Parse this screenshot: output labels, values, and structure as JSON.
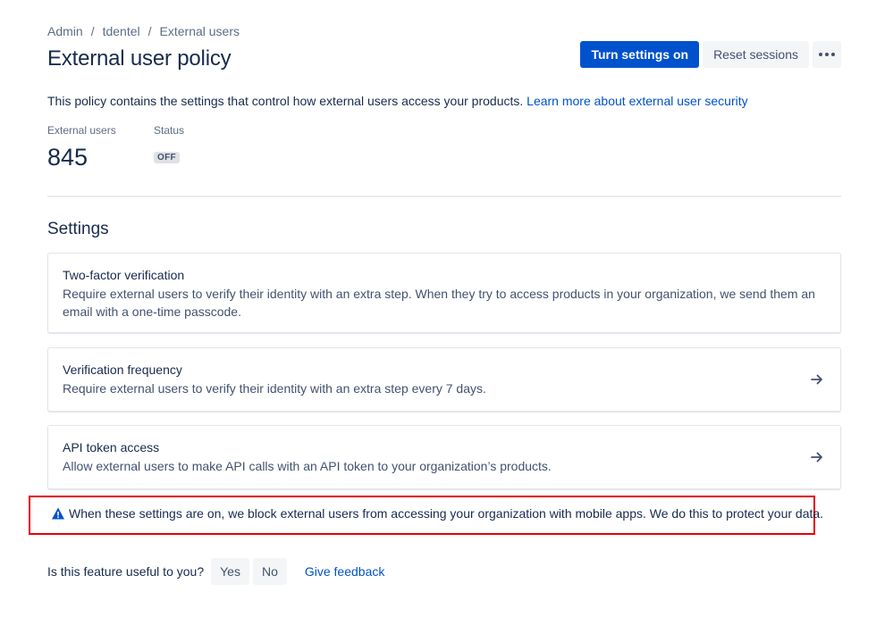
{
  "breadcrumb": {
    "items": [
      "Admin",
      "tdentel",
      "External users"
    ],
    "separator": "/"
  },
  "page": {
    "title": "External user policy"
  },
  "actions": {
    "primary_label": "Turn settings on",
    "reset_label": "Reset sessions",
    "more_icon": "more-horizontal-icon"
  },
  "description": {
    "text": "This policy contains the settings that control how external users access your products.",
    "link_text": "Learn more about external user security"
  },
  "stats": {
    "users_label": "External users",
    "users_value": "845",
    "status_label": "Status",
    "status_value": "OFF"
  },
  "settings": {
    "title": "Settings",
    "cards": [
      {
        "title": "Two-factor verification",
        "body": "Require external users to verify their identity with an extra step. When they try to access products in your organization, we send them an email with a one-time passcode."
      },
      {
        "title": "Verification frequency",
        "body": "Require external users to verify their identity with an extra step every 7 days.",
        "icon": "arrow-right-icon"
      },
      {
        "title": "API token access",
        "body": "Allow external users to make API calls with an API token to your organization’s products.",
        "icon": "arrow-right-icon"
      }
    ]
  },
  "warning": {
    "icon": "warning-icon",
    "text": "When these settings are on, we block external users from accessing your organization with mobile apps. We do this to protect your data."
  },
  "feedback": {
    "question": "Is this feature useful to you?",
    "yes_label": "Yes",
    "no_label": "No",
    "link_label": "Give feedback"
  },
  "colors": {
    "primary": "#0052cc",
    "text": "#172b4d",
    "subtle": "#5e6c84",
    "warning": "#0052cc",
    "highlight": "#e3000f"
  }
}
